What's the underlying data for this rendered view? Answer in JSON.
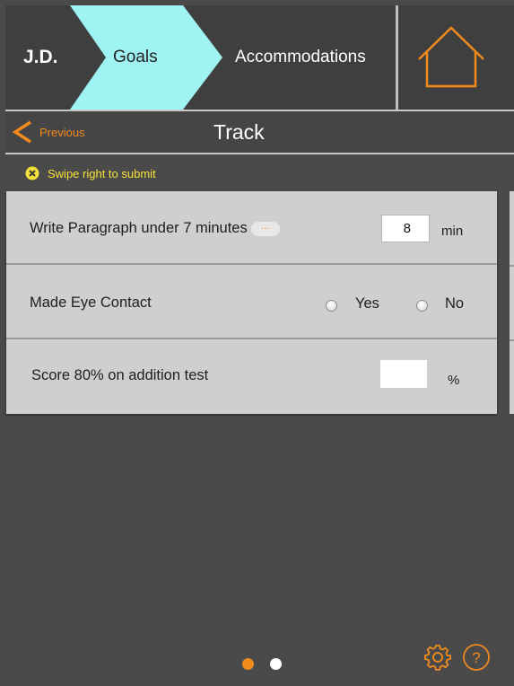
{
  "nav": {
    "student_initials": "J.D.",
    "goals_tab": "Goals",
    "accommodations_tab": "Accommodations",
    "home_icon": "home-icon"
  },
  "track": {
    "previous_label": "Previous",
    "title": "Track",
    "info_text": "Swipe right to submit"
  },
  "goals": [
    {
      "label": "Write Paragraph under 7 minutes",
      "more": "…",
      "value": "8",
      "unit": "min"
    },
    {
      "label": "Made Eye Contact",
      "option_yes": "Yes",
      "option_no": "No",
      "selected": null
    },
    {
      "label": "Score 80% on addition test",
      "value": "",
      "unit": "%"
    }
  ],
  "pager": {
    "pages": 2,
    "current": 1
  },
  "footer": {
    "settings_icon": "gear-icon",
    "help_icon": "help-icon",
    "help_glyph": "?"
  },
  "colors": {
    "background": "#4a4a4a",
    "header": "#3f3f3f",
    "active_tab": "#9ff3f3",
    "accent_orange": "#f28a1c",
    "info_yellow": "#f6e23a",
    "row_background": "#cfcfcf"
  }
}
